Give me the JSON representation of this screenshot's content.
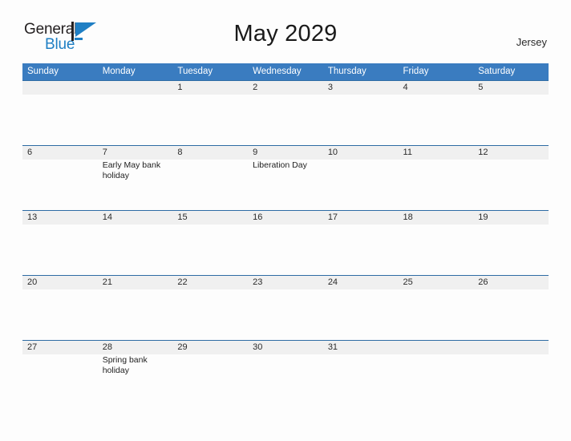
{
  "logo": {
    "word_one": "General",
    "word_two": "Blue",
    "icon": "flag-triangle-icon",
    "flag_color": "#1f7fc4",
    "pole_color": "#231f20"
  },
  "header": {
    "title": "May 2029",
    "region": "Jersey",
    "accent_color": "#3a7cc0"
  },
  "calendar": {
    "weekday_headers": [
      "Sunday",
      "Monday",
      "Tuesday",
      "Wednesday",
      "Thursday",
      "Friday",
      "Saturday"
    ],
    "band_color": "#f0f0f0",
    "rule_color": "#2e6ca4",
    "weeks": [
      [
        {
          "day": "",
          "event": ""
        },
        {
          "day": "",
          "event": ""
        },
        {
          "day": "1",
          "event": ""
        },
        {
          "day": "2",
          "event": ""
        },
        {
          "day": "3",
          "event": ""
        },
        {
          "day": "4",
          "event": ""
        },
        {
          "day": "5",
          "event": ""
        }
      ],
      [
        {
          "day": "6",
          "event": ""
        },
        {
          "day": "7",
          "event": "Early May bank holiday"
        },
        {
          "day": "8",
          "event": ""
        },
        {
          "day": "9",
          "event": "Liberation Day"
        },
        {
          "day": "10",
          "event": ""
        },
        {
          "day": "11",
          "event": ""
        },
        {
          "day": "12",
          "event": ""
        }
      ],
      [
        {
          "day": "13",
          "event": ""
        },
        {
          "day": "14",
          "event": ""
        },
        {
          "day": "15",
          "event": ""
        },
        {
          "day": "16",
          "event": ""
        },
        {
          "day": "17",
          "event": ""
        },
        {
          "day": "18",
          "event": ""
        },
        {
          "day": "19",
          "event": ""
        }
      ],
      [
        {
          "day": "20",
          "event": ""
        },
        {
          "day": "21",
          "event": ""
        },
        {
          "day": "22",
          "event": ""
        },
        {
          "day": "23",
          "event": ""
        },
        {
          "day": "24",
          "event": ""
        },
        {
          "day": "25",
          "event": ""
        },
        {
          "day": "26",
          "event": ""
        }
      ],
      [
        {
          "day": "27",
          "event": ""
        },
        {
          "day": "28",
          "event": "Spring bank holiday"
        },
        {
          "day": "29",
          "event": ""
        },
        {
          "day": "30",
          "event": ""
        },
        {
          "day": "31",
          "event": ""
        },
        {
          "day": "",
          "event": ""
        },
        {
          "day": "",
          "event": ""
        }
      ]
    ]
  }
}
